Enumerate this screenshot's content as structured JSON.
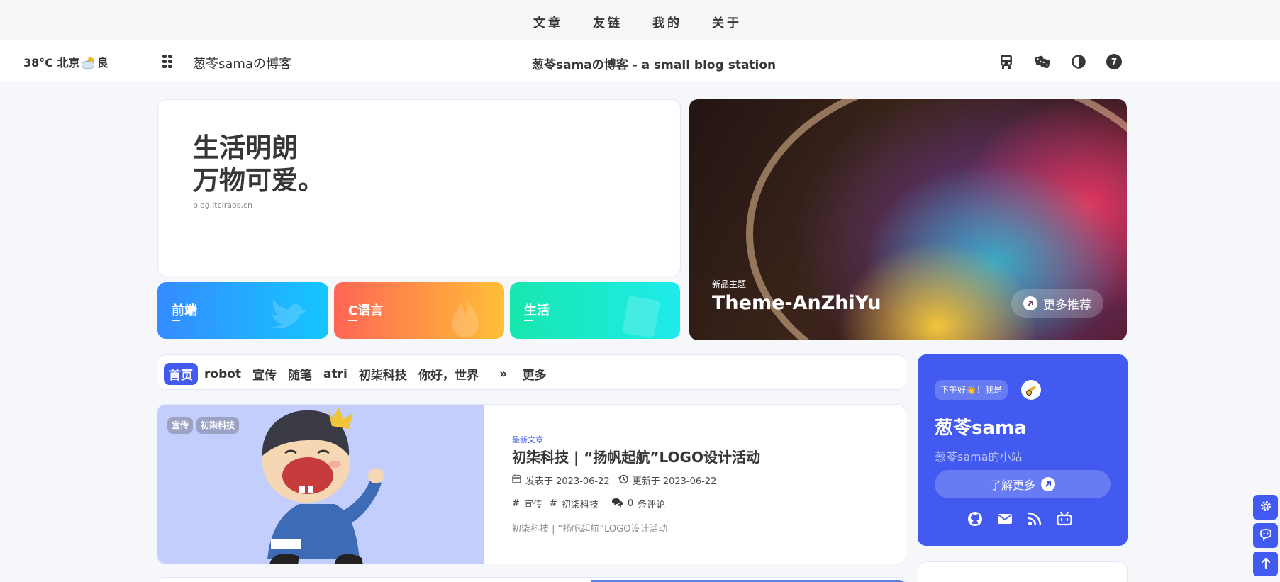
{
  "top_nav": {
    "items": [
      "文章",
      "友链",
      "我的",
      "关于"
    ]
  },
  "header": {
    "weather": {
      "temp_city": "38°C 北京",
      "quality": "良"
    },
    "site_name": "葱苓samaの博客",
    "site_title": "葱苓samaの博客 - a small blog station",
    "badge_count": "7"
  },
  "hero": {
    "slogan_line1": "生活明朗",
    "slogan_line2": "万物可爱。",
    "url": "blog.itciraos.cn",
    "categories": [
      {
        "label": "前端",
        "color_from": "#358bff",
        "color_to": "#15c6ff"
      },
      {
        "label": "C语言",
        "color_from": "#f65",
        "color_to": "#ffbf37"
      },
      {
        "label": "生活",
        "color_from": "#18e7ae",
        "color_to": "#1eebeb"
      }
    ]
  },
  "feature": {
    "tag": "新品主题",
    "name": "Theme-AnZhiYu",
    "more_label": "更多推荐"
  },
  "tabs": {
    "items": [
      "首页",
      "robot",
      "宣传",
      "随笔",
      "atri",
      "初柒科技",
      "你好，世界"
    ],
    "active_index": 0,
    "more_label": "更多"
  },
  "post": {
    "tags": [
      "宣传",
      "初柒科技"
    ],
    "newest_label": "最新文章",
    "title": "初柒科技 | “扬帆起航”LOGO设计活动",
    "published": "发表于 2023-06-22",
    "updated": "更新于 2023-06-22",
    "post_tags": [
      "宣传",
      "初柒科技"
    ],
    "comments_count": "0",
    "comments_label": "条评论",
    "excerpt": "初柒科技 | “扬帆起航”LOGO设计活动"
  },
  "profile": {
    "greeting": "下午好👋！我是",
    "name": "葱苓sama",
    "desc": "葱苓sama的小站",
    "learn_more": "了解更多"
  },
  "colors": {
    "accent": "#425aef",
    "text": "#363636",
    "background": "#f5f7fb"
  }
}
